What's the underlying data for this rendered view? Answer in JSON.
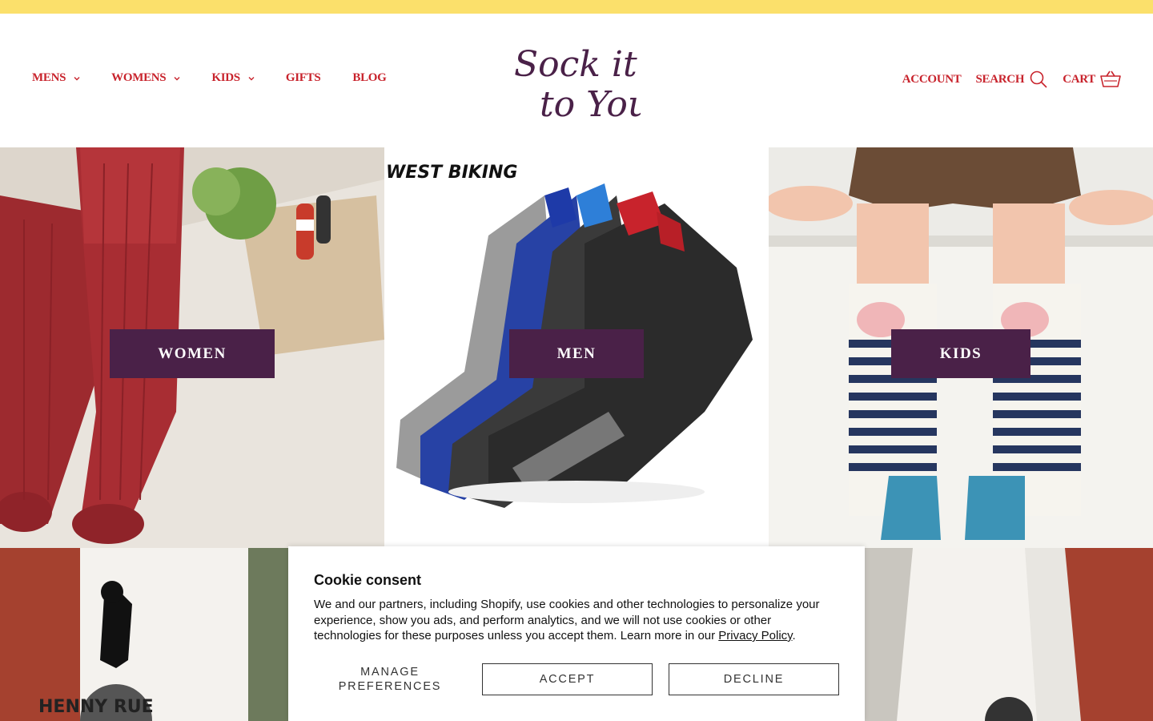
{
  "nav": {
    "left": [
      {
        "label": "MENS",
        "dropdown": true
      },
      {
        "label": "WOMENS",
        "dropdown": true
      },
      {
        "label": "KIDS",
        "dropdown": true
      },
      {
        "label": "GIFTS",
        "dropdown": false
      },
      {
        "label": "BLOG",
        "dropdown": false
      }
    ],
    "account_label": "ACCOUNT",
    "search_label": "SEARCH",
    "cart_label": "CART"
  },
  "logo": {
    "line1": "Sock it",
    "line2": "to You"
  },
  "tiles": [
    {
      "label": "WOMEN"
    },
    {
      "label": "MEN",
      "brand": "WEST BIKING"
    },
    {
      "label": "KIDS"
    }
  ],
  "row2": {
    "brand": "HENNY RUE"
  },
  "cookie": {
    "title": "Cookie consent",
    "body": "We and our partners, including Shopify, use cookies and other technologies to personalize your experience, show you ads, and perform analytics, and we will not use cookies or other technologies for these purposes unless you accept them. Learn more in our ",
    "link": "Privacy Policy",
    "period": ".",
    "manage_label": "MANAGE PREFERENCES",
    "accept_label": "ACCEPT",
    "decline_label": "DECLINE"
  },
  "colors": {
    "announce_bar": "#fbe06b",
    "nav_text": "#c8232c",
    "tile_button": "#4a2148",
    "logo": "#4a2148"
  },
  "icons": [
    "chevron-down-icon",
    "search-icon",
    "cart-icon"
  ]
}
